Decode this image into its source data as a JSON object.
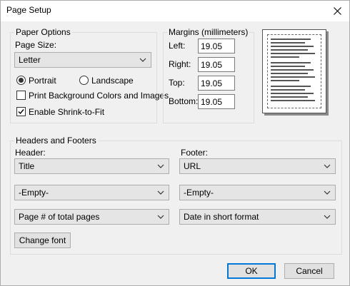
{
  "window": {
    "title": "Page Setup"
  },
  "paper_options": {
    "group_label": "Paper Options",
    "page_size_label": "Page Size:",
    "page_size_value": "Letter",
    "portrait_label": "Portrait",
    "landscape_label": "Landscape",
    "orientation": "portrait",
    "print_background_label": "Print Background Colors and Images",
    "print_background_checked": false,
    "shrink_to_fit_label": "Enable Shrink-to-Fit",
    "shrink_to_fit_checked": true
  },
  "margins": {
    "group_label": "Margins (millimeters)",
    "left_label": "Left:",
    "left_value": "19.05",
    "right_label": "Right:",
    "right_value": "19.05",
    "top_label": "Top:",
    "top_value": "19.05",
    "bottom_label": "Bottom:",
    "bottom_value": "19.05"
  },
  "headers_footers": {
    "group_label": "Headers and Footers",
    "header_label": "Header:",
    "footer_label": "Footer:",
    "header_values": [
      "Title",
      "-Empty-",
      "Page # of total pages"
    ],
    "footer_values": [
      "URL",
      "-Empty-",
      "Date in short format"
    ],
    "change_font_label": "Change font"
  },
  "buttons": {
    "ok_label": "OK",
    "cancel_label": "Cancel"
  },
  "icons": {
    "close": "close-icon",
    "chevron": "chevron-down-icon"
  }
}
